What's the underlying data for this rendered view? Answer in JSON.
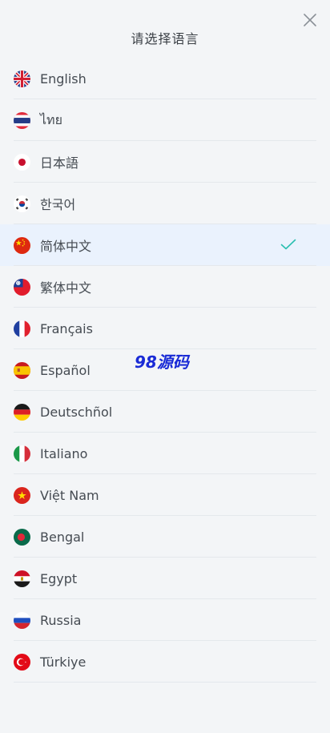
{
  "header": {
    "title": "请选择语言"
  },
  "languages": [
    {
      "label": "English",
      "flag": "uk-flag-icon"
    },
    {
      "label": "ไทย",
      "flag": "thailand-flag-icon"
    },
    {
      "label": "日本語",
      "flag": "japan-flag-icon"
    },
    {
      "label": "한국어",
      "flag": "korea-flag-icon"
    },
    {
      "label": "简体中文",
      "flag": "china-flag-icon",
      "selected": true
    },
    {
      "label": "繁体中文",
      "flag": "taiwan-flag-icon"
    },
    {
      "label": "Français",
      "flag": "france-flag-icon"
    },
    {
      "label": "Español",
      "flag": "spain-flag-icon"
    },
    {
      "label": "Deutschñol",
      "flag": "germany-flag-icon"
    },
    {
      "label": "Italiano",
      "flag": "italy-flag-icon"
    },
    {
      "label": "Việt Nam",
      "flag": "vietnam-flag-icon"
    },
    {
      "label": "Bengal",
      "flag": "bangladesh-flag-icon"
    },
    {
      "label": "Egypt",
      "flag": "egypt-flag-icon"
    },
    {
      "label": "Russia",
      "flag": "russia-flag-icon"
    },
    {
      "label": "Türkiye",
      "flag": "turkey-flag-icon"
    }
  ],
  "watermark": "98源码",
  "colors": {
    "background": "#f3f5f7",
    "selected_row": "#eaf2fd",
    "check": "#2bbfb0",
    "watermark": "#1a2bd6"
  }
}
